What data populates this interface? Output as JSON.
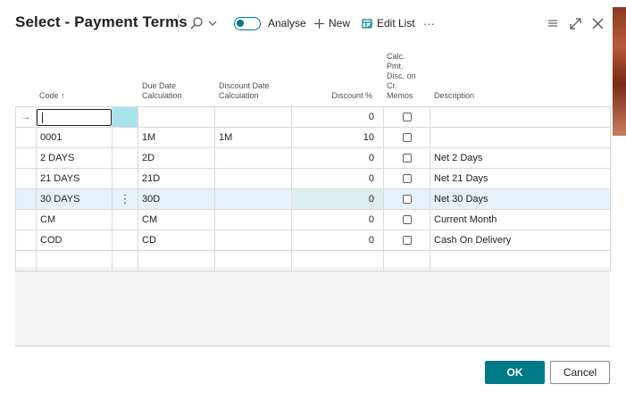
{
  "window": {
    "title": "Select - Payment Terms"
  },
  "toolbar": {
    "analyse_label": "Analyse",
    "new_label": "New",
    "edit_list_label": "Edit List",
    "more_label": "···"
  },
  "columns": {
    "code": "Code",
    "code_sort": "↑",
    "due_line1": "Due Date",
    "due_line2": "Calculation",
    "disc_line1": "Discount Date",
    "disc_line2": "Calculation",
    "pct": "Discount %",
    "calc_line1": "Calc.",
    "calc_line2": "Pmt.",
    "calc_line3": "Disc. on",
    "calc_line4": "Cr.",
    "calc_line5": "Memos",
    "desc": "Description"
  },
  "new_row": {
    "indicator": "→",
    "discount": "0"
  },
  "rows": [
    {
      "code": "0001",
      "due": "1M",
      "disc": "1M",
      "pct": "10",
      "desc": ""
    },
    {
      "code": "2 DAYS",
      "due": "2D",
      "disc": "",
      "pct": "0",
      "desc": "Net 2 Days"
    },
    {
      "code": "21 DAYS",
      "due": "21D",
      "disc": "",
      "pct": "0",
      "desc": "Net 21 Days"
    },
    {
      "code": "30 DAYS",
      "due": "30D",
      "disc": "",
      "pct": "0",
      "desc": "Net 30 Days"
    },
    {
      "code": "CM",
      "due": "CM",
      "disc": "",
      "pct": "0",
      "desc": "Current Month"
    },
    {
      "code": "COD",
      "due": "CD",
      "disc": "",
      "pct": "0",
      "desc": "Cash On Delivery"
    }
  ],
  "row_menu_icon": "⋮",
  "buttons": {
    "ok": "OK",
    "cancel": "Cancel"
  },
  "colors": {
    "accent": "#00798a",
    "selected_row": "#e6f2fb",
    "edit_cell": "#a6e4ec"
  }
}
